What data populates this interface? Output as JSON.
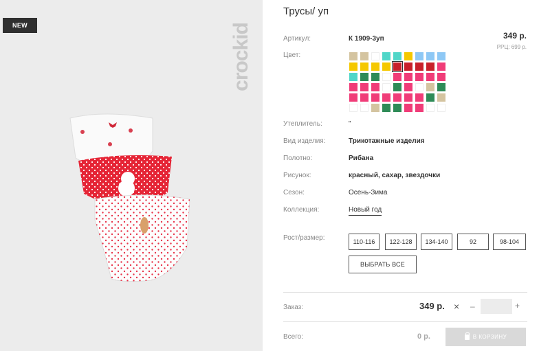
{
  "badge": "NEW",
  "brand_logo": "crockid",
  "product": {
    "title": "Трусы/ уп",
    "price": "349 р.",
    "rrc": "РРЦ: 699 р."
  },
  "labels": {
    "article": "Артикул:",
    "color": "Цвет:",
    "insulation": "Утеплитель:",
    "item_type": "Вид изделия:",
    "fabric": "Полотно:",
    "pattern": "Рисунок:",
    "season": "Сезон:",
    "collection": "Коллекция:",
    "size": "Рост/размер:",
    "order": "Заказ:",
    "total": "Всего:"
  },
  "values": {
    "article": "К 1909-3уп",
    "insulation": "\"",
    "item_type": "Трикотажные изделия",
    "fabric": "Рибана",
    "pattern": "красный, сахар, звездочки",
    "season": "Осень-Зима",
    "collection": "Новый год"
  },
  "colors": {
    "accent_dark": "#333333",
    "badge_bg": "#2f2f2f",
    "photo_bg": "#ececec"
  },
  "swatches": [
    "#d4c4a0",
    "#d4c4a0",
    "#ffffff",
    "#4fd6c8",
    "#4fd6c8",
    "#f5c800",
    "#8ec8f5",
    "#8ec8f5",
    "#8ec8f5",
    "#f5c800",
    "#f5c800",
    "#f5c800",
    "#f5c800",
    "#c8202a",
    "#c8202a",
    "#c8202a",
    "#c8202a",
    "#f03c78",
    "#4fd6c8",
    "#2e8b57",
    "#2e8b57",
    "#ffffff",
    "#f03c78",
    "#f03c78",
    "#f03c78",
    "#f03c78",
    "#f03c78",
    "#f03c78",
    "#f03c78",
    "#f03c78",
    "#ffffff",
    "#2e8b57",
    "#f03c78",
    "#ffffff",
    "#d4c4a0",
    "#2e8b57",
    "#f03c78",
    "#f03c78",
    "#f03c78",
    "#f03c78",
    "#f03c78",
    "#f03c78",
    "#f03c78",
    "#2e8b57",
    "#d4c4a0",
    "#ffffff",
    "#ffffff",
    "#d4c4a0",
    "#2e8b57",
    "#2e8b57",
    "#f03c78",
    "#f03c78",
    "#ffffff",
    "#ffffff"
  ],
  "selected_swatch_index": 13,
  "sizes": [
    "110-116",
    "122-128",
    "134-140",
    "92",
    "98-104"
  ],
  "select_all": "ВЫБРАТЬ ВСЕ",
  "order": {
    "price": "349 р.",
    "times": "×",
    "minus": "–",
    "plus": "+",
    "quantity": ""
  },
  "total": {
    "value": "0 р.",
    "cart_button": "В КОРЗИНУ"
  }
}
